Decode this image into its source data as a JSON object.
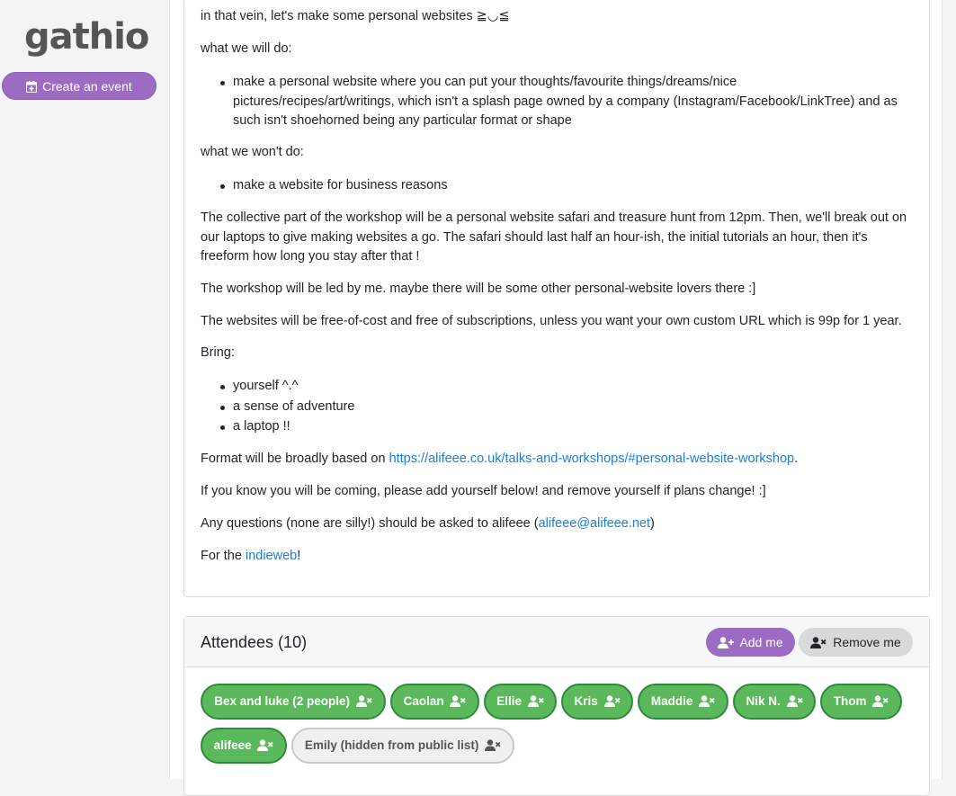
{
  "sidebar": {
    "logo": "gathio",
    "create_label": "Create an event"
  },
  "description": {
    "intro": "in that vein, let's make some personal websites ≧◡≦",
    "will_heading": "what we will do:",
    "will_items": [
      "make a personal website where you can put your thoughts/favourite things/dreams/nice pictures/recipes/art/writings, which isn't a splash page owned by a company (Instagram/Facebook/LinkTree) and as such isn't shoehorned being any particular format or shape"
    ],
    "wont_heading": "what we won't do:",
    "wont_items": [
      "make a website for business reasons"
    ],
    "collective": "The collective part of the workshop will be a personal website safari and treasure hunt from 12pm. Then, we'll break out on our laptops to give making websites a go. The safari should last half an hour-ish, the initial tutorials an hour, then it's freeform how long you stay after that !",
    "led_by": "The workshop will be led by me. maybe there will be some other personal-website lovers there :]",
    "cost": "The websites will be free-of-cost and free of subscriptions, unless you want your own custom URL which is 99p for 1 year.",
    "bring_heading": "Bring:",
    "bring_items": [
      "yourself ^.^",
      "a sense of adventure",
      "a laptop !!"
    ],
    "format_prefix": "Format will be broadly based on ",
    "format_link": "https://alifeee.co.uk/talks-and-workshops/#personal-website-workshop",
    "format_suffix": ".",
    "coming": "If you know you will be coming, please add yourself below! and remove yourself if plans change! :]",
    "questions_prefix": "Any questions (none are silly!) should be asked to alifeee (",
    "questions_link": "alifeee@alifeee.net",
    "questions_suffix": ")",
    "for_prefix": "For the ",
    "for_link": "indieweb",
    "for_suffix": "!"
  },
  "attendees": {
    "title": "Attendees (10)",
    "add_label": "Add me",
    "remove_label": "Remove me",
    "list": [
      {
        "name": "Bex and luke (2 people)",
        "hidden": false
      },
      {
        "name": "Caolan",
        "hidden": false
      },
      {
        "name": "Ellie",
        "hidden": false
      },
      {
        "name": "Kris",
        "hidden": false
      },
      {
        "name": "Maddie",
        "hidden": false
      },
      {
        "name": "Nik N.",
        "hidden": false
      },
      {
        "name": "Thom",
        "hidden": false
      },
      {
        "name": "alifeee",
        "hidden": false
      },
      {
        "name": "Emily (hidden from public list)",
        "hidden": true
      }
    ]
  },
  "colors": {
    "accent": "#9c6cc4",
    "attendee": "#5cb85c",
    "link": "#1a7fd6"
  }
}
